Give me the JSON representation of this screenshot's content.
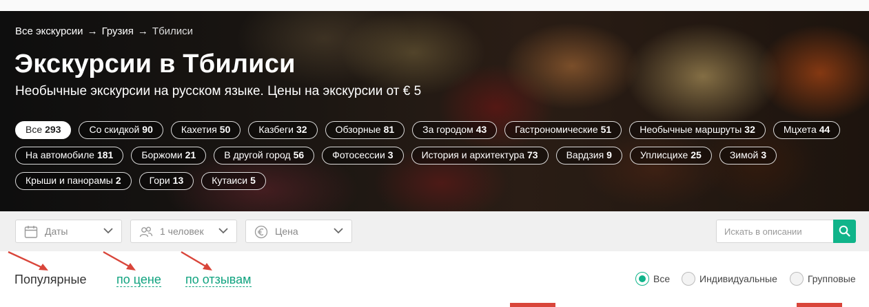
{
  "breadcrumb": {
    "items": [
      "Все экскурсии",
      "Грузия",
      "Тбилиси"
    ],
    "separator": "→"
  },
  "hero": {
    "title": "Экскурсии в Тбилиси",
    "subtitle": "Необычные экскурсии на русском языке. Цены на экскурсии от € 5"
  },
  "chips": [
    {
      "label": "Все",
      "count": "293",
      "active": true
    },
    {
      "label": "Со скидкой",
      "count": "90"
    },
    {
      "label": "Кахетия",
      "count": "50"
    },
    {
      "label": "Казбеги",
      "count": "32"
    },
    {
      "label": "Обзорные",
      "count": "81"
    },
    {
      "label": "За городом",
      "count": "43"
    },
    {
      "label": "Гастрономические",
      "count": "51"
    },
    {
      "label": "Необычные маршруты",
      "count": "32"
    },
    {
      "label": "Мцхета",
      "count": "44"
    },
    {
      "label": "На автомобиле",
      "count": "181"
    },
    {
      "label": "Боржоми",
      "count": "21"
    },
    {
      "label": "В другой город",
      "count": "56"
    },
    {
      "label": "Фотосессии",
      "count": "3"
    },
    {
      "label": "История и архитектура",
      "count": "73"
    },
    {
      "label": "Вардзия",
      "count": "9"
    },
    {
      "label": "Уплисцихе",
      "count": "25"
    },
    {
      "label": "Зимой",
      "count": "3"
    },
    {
      "label": "Крыши и панорамы",
      "count": "2"
    },
    {
      "label": "Гори",
      "count": "13"
    },
    {
      "label": "Кутаиси",
      "count": "5"
    }
  ],
  "filters": {
    "dates": {
      "label": "Даты",
      "icon": "calendar-icon"
    },
    "people": {
      "label": "1 человек",
      "icon": "people-icon"
    },
    "price": {
      "label": "Цена",
      "icon": "euro-icon"
    },
    "search": {
      "placeholder": "Искать в описании",
      "icon": "search-icon"
    }
  },
  "sort": {
    "popular": "Популярные",
    "by_price": "по цене",
    "by_reviews": "по отзывам"
  },
  "type_filter": {
    "options": [
      {
        "label": "Все",
        "checked": true
      },
      {
        "label": "Индивидуальные",
        "checked": false
      },
      {
        "label": "Групповые",
        "checked": false
      }
    ]
  },
  "colors": {
    "accent": "#10b48a",
    "link": "#10a37f",
    "annotation_arrow": "#d9453a"
  }
}
